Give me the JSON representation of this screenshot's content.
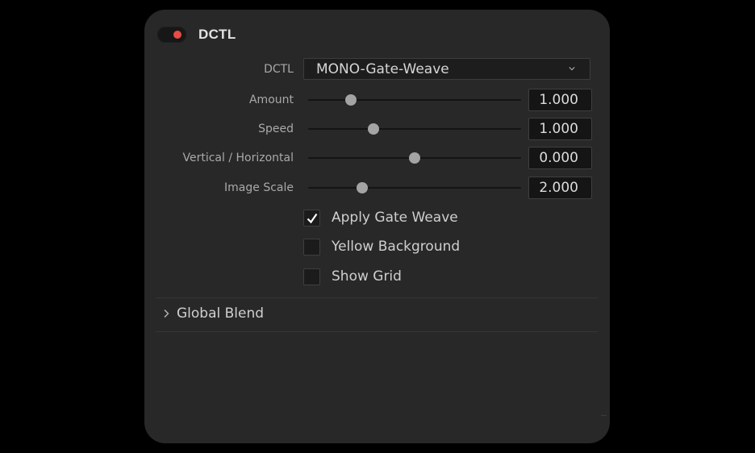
{
  "header": {
    "title": "DCTL",
    "enabled": true,
    "toggle_color": "#e84a46"
  },
  "dctl": {
    "label": "DCTL",
    "selected": "MONO-Gate-Weave",
    "icon": "chevron-down-icon"
  },
  "params": [
    {
      "label": "Amount",
      "value": "1.000",
      "slider_position": 0.2
    },
    {
      "label": "Speed",
      "value": "1.000",
      "slider_position": 0.305
    },
    {
      "label": "Vertical / Horizontal",
      "value": "0.000",
      "slider_position": 0.5
    },
    {
      "label": "Image Scale",
      "value": "2.000",
      "slider_position": 0.255
    }
  ],
  "checkboxes": [
    {
      "label": "Apply Gate Weave",
      "checked": true
    },
    {
      "label": "Yellow Background",
      "checked": false
    },
    {
      "label": "Show Grid",
      "checked": false
    }
  ],
  "sections": [
    {
      "label": "Global Blend",
      "expanded": false,
      "icon": "chevron-right-icon"
    }
  ]
}
